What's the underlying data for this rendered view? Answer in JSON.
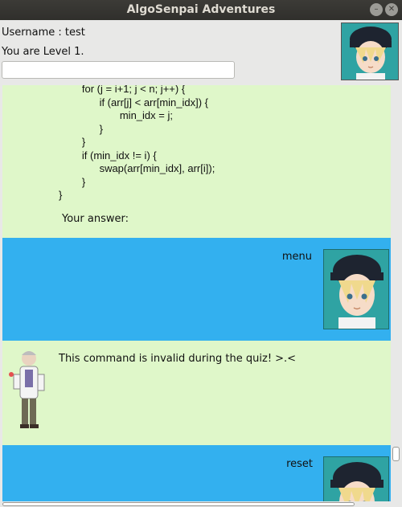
{
  "window": {
    "title": "AlgoSenpai Adventures"
  },
  "header": {
    "username_line": "Username : test",
    "level_line": "You are Level 1.",
    "command_input_value": ""
  },
  "chat": {
    "code_lines": [
      "        for (j = i+1; j < n; j++) {",
      "              if (arr[j] < arr[min_idx]) {",
      "                     min_idx = j;",
      "              }",
      "        }",
      "        if (min_idx != i) {",
      "              swap(arr[min_idx], arr[i]);",
      "        }",
      "}"
    ],
    "answer_prompt": "Your answer:",
    "user_message_1": "menu",
    "bot_message": "This command is invalid during the quiz! >.<",
    "user_message_2": "reset"
  },
  "colors": {
    "green_bubble": "#dff7c9",
    "blue_bubble": "#33b0ef",
    "title_bar": "#3c3b37"
  },
  "icons": {
    "window_minimize": "minimize-icon",
    "window_close": "close-icon"
  }
}
